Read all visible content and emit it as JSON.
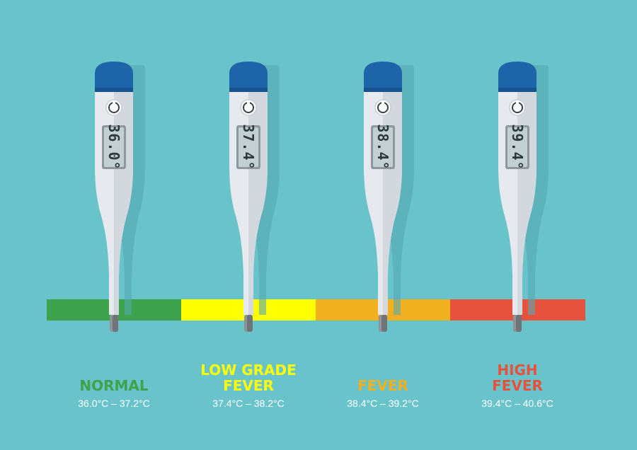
{
  "colors": {
    "background": "#69c3cb",
    "thermometer_body": "#e6e9ee",
    "thermometer_cap": "#1d64a8",
    "lcd_screen": "#c4cfd3",
    "normal": "#3fa34d",
    "low_grade_fever": "#ffff00",
    "fever": "#f1b020",
    "high_fever": "#e7523f"
  },
  "thermometers": [
    {
      "reading": "36.0°",
      "category": "NORMAL",
      "range": "36.0°C – 37.2°C",
      "color": "#3fa34d"
    },
    {
      "reading": "37.4°",
      "category": "LOW GRADE\nFEVER",
      "range": "37.4°C – 38.2°C",
      "color": "#ffff00"
    },
    {
      "reading": "38.4°",
      "category": "FEVER",
      "range": "38.4°C – 39.2°C",
      "color": "#f1b020"
    },
    {
      "reading": "39.4°",
      "category": "HIGH\nFEVER",
      "range": "39.4°C – 40.6°C",
      "color": "#e7523f"
    }
  ],
  "icons": {
    "power_button": "power-button-icon"
  }
}
